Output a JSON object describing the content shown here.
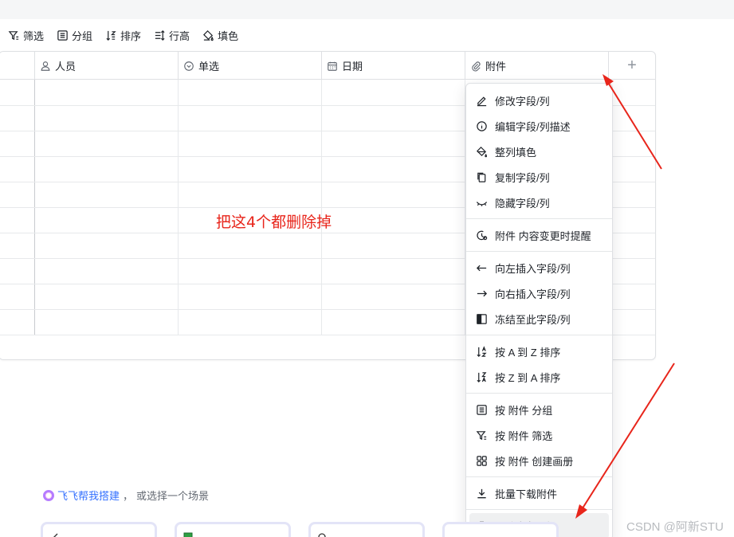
{
  "toolbar": {
    "filter": "筛选",
    "group": "分组",
    "sort": "排序",
    "row_height": "行高",
    "fill": "填色"
  },
  "columns": [
    {
      "label": "人员",
      "icon": "person-icon"
    },
    {
      "label": "单选",
      "icon": "radio-icon"
    },
    {
      "label": "日期",
      "icon": "calendar-icon"
    },
    {
      "label": "附件",
      "icon": "paperclip-icon"
    }
  ],
  "add_column": "+",
  "annotation": "把这4个都删除掉",
  "menu": {
    "edit_field": "修改字段/列",
    "edit_desc": "编辑字段/列描述",
    "fill_column": "整列填色",
    "copy_field": "复制字段/列",
    "hide_field": "隐藏字段/列",
    "remind": "附件 内容变更时提醒",
    "insert_left": "向左插入字段/列",
    "insert_right": "向右插入字段/列",
    "freeze": "冻结至此字段/列",
    "sort_az": "按 A 到 Z 排序",
    "sort_za": "按 Z 到 A 排序",
    "group_by": "按 附件 分组",
    "filter_by": "按 附件 筛选",
    "create_gallery": "按 附件 创建画册",
    "batch_download": "批量下载附件",
    "delete_field": "删除字段/列"
  },
  "helper": {
    "link": "飞飞帮我搭建",
    "comma": "，",
    "rest": "或选择一个场景"
  },
  "watermark": "CSDN @阿新STU",
  "colors": {
    "accent": "#3370ff",
    "annotation": "#e8251b"
  }
}
